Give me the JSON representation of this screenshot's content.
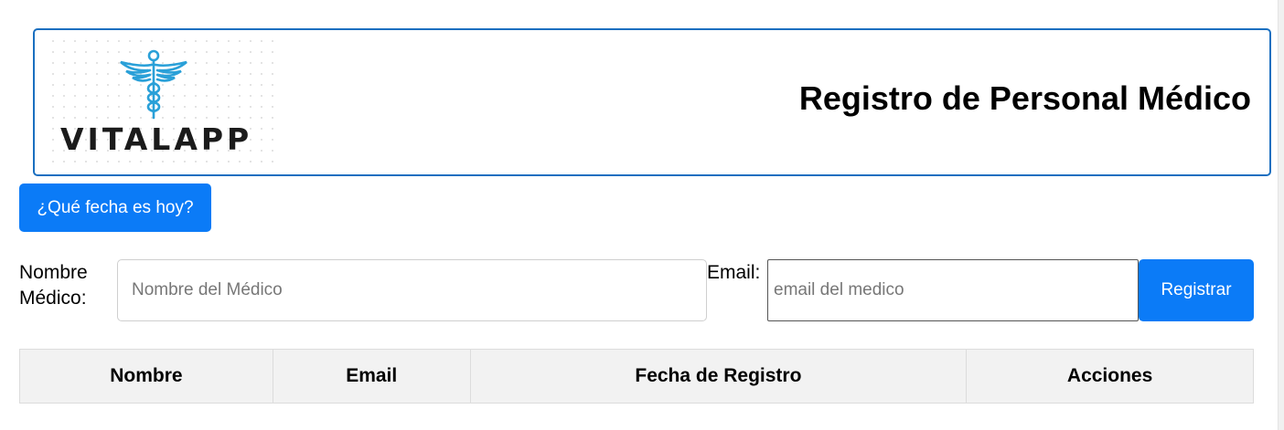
{
  "header": {
    "logo_text": "VITALAPP",
    "logo_icon": "caduceus-icon",
    "title": "Registro de Personal Médico"
  },
  "date_button": {
    "label": "¿Qué fecha es hoy?"
  },
  "form": {
    "nombre_label": "Nombre Médico:",
    "nombre_placeholder": "Nombre del Médico",
    "nombre_value": "",
    "email_label": "Email:",
    "email_placeholder": "email del medico",
    "email_value": "",
    "submit_label": "Registrar"
  },
  "table": {
    "columns": [
      "Nombre",
      "Email",
      "Fecha de Registro",
      "Acciones"
    ],
    "rows": []
  },
  "colors": {
    "accent": "#0b7bf7",
    "header_border": "#1a6fc0",
    "logo_icon": "#2aa0d8",
    "table_header_bg": "#f2f2f2"
  }
}
